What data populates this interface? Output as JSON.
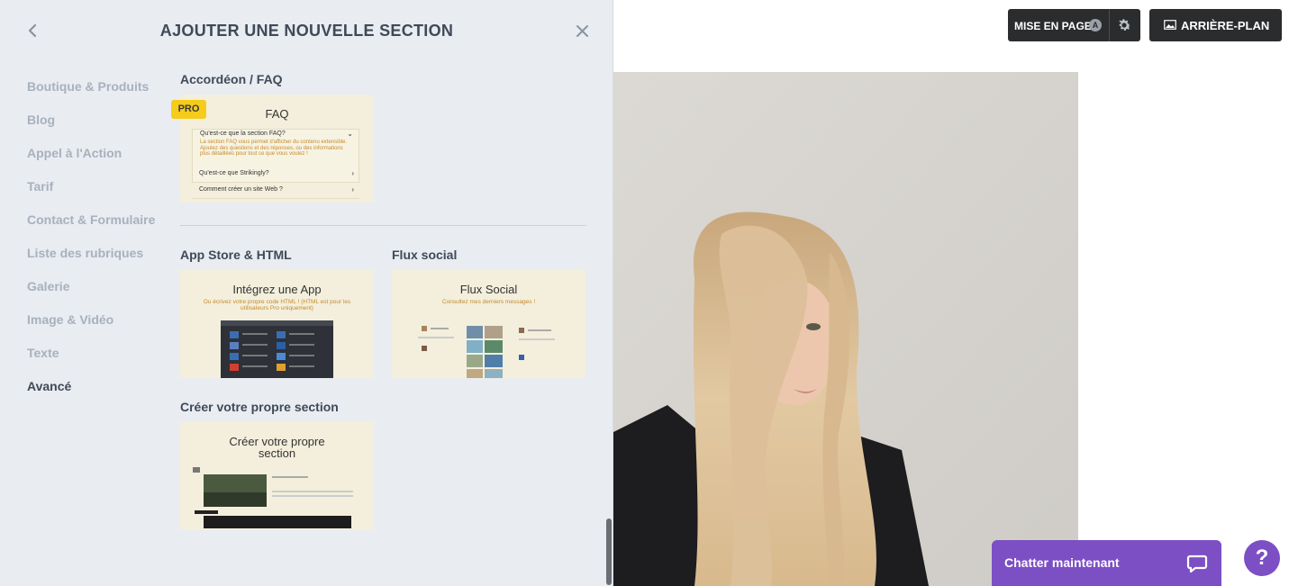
{
  "panel": {
    "title": "AJOUTER UNE NOUVELLE SECTION",
    "nav": [
      {
        "label": "Boutique & Produits",
        "active": false
      },
      {
        "label": "Blog",
        "active": false
      },
      {
        "label": "Appel à l'Action",
        "active": false
      },
      {
        "label": "Tarif",
        "active": false
      },
      {
        "label": "Contact & Formulaire",
        "active": false
      },
      {
        "label": "Liste des rubriques",
        "active": false
      },
      {
        "label": "Galerie",
        "active": false
      },
      {
        "label": "Image & Vidéo",
        "active": false
      },
      {
        "label": "Texte",
        "active": false
      },
      {
        "label": "Avancé",
        "active": true
      }
    ],
    "sections": {
      "faq": {
        "heading": "Accordéon / FAQ",
        "badge": "PRO",
        "card_title": "FAQ",
        "q1": "Qu'est-ce que la section FAQ?",
        "a1": "La section FAQ vous permet d'afficher du contenu extensible. Ajoutez des questions et des réponses, ou des informations plus détaillées pour tout ce que vous voulez !",
        "q2": "Qu'est-ce que Strikingly?",
        "q3": "Comment créer un site Web ?"
      },
      "app": {
        "heading": "App Store & HTML",
        "card_title": "Intégrez une App",
        "card_sub": "Ou écrivez votre propre code HTML ! (HTML est pour les utilisateurs Pro uniquement)"
      },
      "social": {
        "heading": "Flux social",
        "card_title": "Flux Social",
        "card_sub": "Consultez mes derniers messages !"
      },
      "custom": {
        "heading": "Créer votre propre section",
        "card_title_l1": "Créer votre propre",
        "card_title_l2": "section"
      }
    }
  },
  "toolbar": {
    "layout_label": "MISE EN PAGE",
    "layout_badge": "A",
    "background_label": "ARRIÈRE-PLAN"
  },
  "chat": {
    "label": "Chatter maintenant",
    "help": "?"
  },
  "colors": {
    "panel_bg": "#e9ecf1",
    "card_bg": "#f3efdc",
    "accent_purple": "#7c4fc4",
    "pro_yellow": "#f5cc1b",
    "dark_button": "#2a2c2e"
  }
}
